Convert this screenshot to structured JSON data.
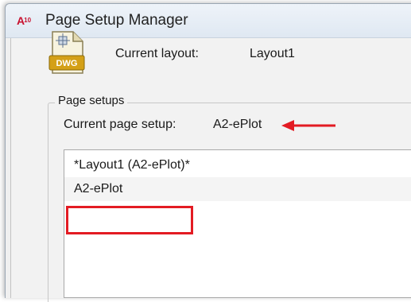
{
  "window": {
    "title": "Page Setup Manager",
    "app_icon": "autocad-icon",
    "app_icon_text": "A",
    "app_icon_sub": "10"
  },
  "layout": {
    "file_icon": "dwg-file-icon",
    "file_icon_label": "DWG",
    "current_layout_label": "Current layout:",
    "current_layout_value": "Layout1"
  },
  "page_setups": {
    "group_label": "Page setups",
    "current_setup_label": "Current page setup:",
    "current_setup_value": "A2-ePlot",
    "items": [
      {
        "label": "*Layout1 (A2-ePlot)*"
      },
      {
        "label": "A2-ePlot"
      }
    ]
  },
  "annotations": {
    "arrow_icon": "red-arrow-left-icon",
    "highlight_color": "#e31b23"
  }
}
